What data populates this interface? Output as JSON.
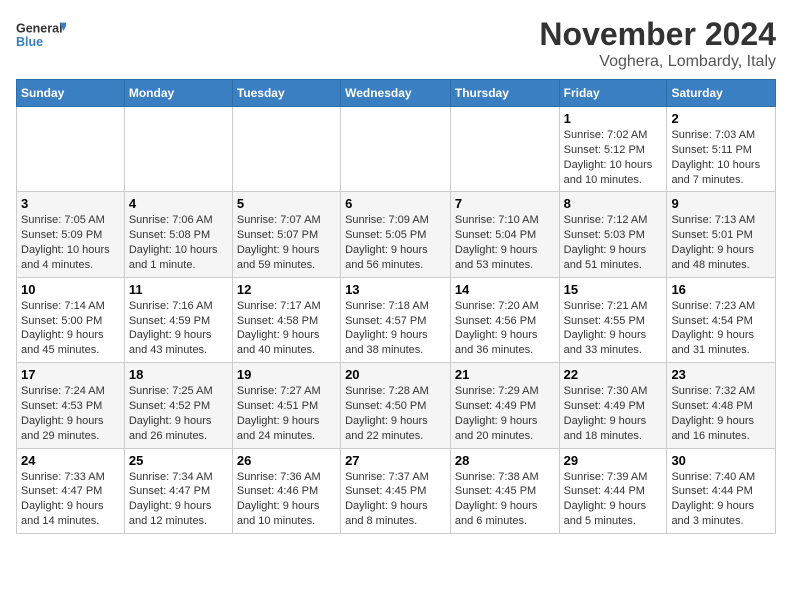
{
  "logo": {
    "line1": "General",
    "line2": "Blue"
  },
  "title": "November 2024",
  "location": "Voghera, Lombardy, Italy",
  "days_of_week": [
    "Sunday",
    "Monday",
    "Tuesday",
    "Wednesday",
    "Thursday",
    "Friday",
    "Saturday"
  ],
  "weeks": [
    [
      {
        "day": "",
        "info": ""
      },
      {
        "day": "",
        "info": ""
      },
      {
        "day": "",
        "info": ""
      },
      {
        "day": "",
        "info": ""
      },
      {
        "day": "",
        "info": ""
      },
      {
        "day": "1",
        "info": "Sunrise: 7:02 AM\nSunset: 5:12 PM\nDaylight: 10 hours and 10 minutes."
      },
      {
        "day": "2",
        "info": "Sunrise: 7:03 AM\nSunset: 5:11 PM\nDaylight: 10 hours and 7 minutes."
      }
    ],
    [
      {
        "day": "3",
        "info": "Sunrise: 7:05 AM\nSunset: 5:09 PM\nDaylight: 10 hours and 4 minutes."
      },
      {
        "day": "4",
        "info": "Sunrise: 7:06 AM\nSunset: 5:08 PM\nDaylight: 10 hours and 1 minute."
      },
      {
        "day": "5",
        "info": "Sunrise: 7:07 AM\nSunset: 5:07 PM\nDaylight: 9 hours and 59 minutes."
      },
      {
        "day": "6",
        "info": "Sunrise: 7:09 AM\nSunset: 5:05 PM\nDaylight: 9 hours and 56 minutes."
      },
      {
        "day": "7",
        "info": "Sunrise: 7:10 AM\nSunset: 5:04 PM\nDaylight: 9 hours and 53 minutes."
      },
      {
        "day": "8",
        "info": "Sunrise: 7:12 AM\nSunset: 5:03 PM\nDaylight: 9 hours and 51 minutes."
      },
      {
        "day": "9",
        "info": "Sunrise: 7:13 AM\nSunset: 5:01 PM\nDaylight: 9 hours and 48 minutes."
      }
    ],
    [
      {
        "day": "10",
        "info": "Sunrise: 7:14 AM\nSunset: 5:00 PM\nDaylight: 9 hours and 45 minutes."
      },
      {
        "day": "11",
        "info": "Sunrise: 7:16 AM\nSunset: 4:59 PM\nDaylight: 9 hours and 43 minutes."
      },
      {
        "day": "12",
        "info": "Sunrise: 7:17 AM\nSunset: 4:58 PM\nDaylight: 9 hours and 40 minutes."
      },
      {
        "day": "13",
        "info": "Sunrise: 7:18 AM\nSunset: 4:57 PM\nDaylight: 9 hours and 38 minutes."
      },
      {
        "day": "14",
        "info": "Sunrise: 7:20 AM\nSunset: 4:56 PM\nDaylight: 9 hours and 36 minutes."
      },
      {
        "day": "15",
        "info": "Sunrise: 7:21 AM\nSunset: 4:55 PM\nDaylight: 9 hours and 33 minutes."
      },
      {
        "day": "16",
        "info": "Sunrise: 7:23 AM\nSunset: 4:54 PM\nDaylight: 9 hours and 31 minutes."
      }
    ],
    [
      {
        "day": "17",
        "info": "Sunrise: 7:24 AM\nSunset: 4:53 PM\nDaylight: 9 hours and 29 minutes."
      },
      {
        "day": "18",
        "info": "Sunrise: 7:25 AM\nSunset: 4:52 PM\nDaylight: 9 hours and 26 minutes."
      },
      {
        "day": "19",
        "info": "Sunrise: 7:27 AM\nSunset: 4:51 PM\nDaylight: 9 hours and 24 minutes."
      },
      {
        "day": "20",
        "info": "Sunrise: 7:28 AM\nSunset: 4:50 PM\nDaylight: 9 hours and 22 minutes."
      },
      {
        "day": "21",
        "info": "Sunrise: 7:29 AM\nSunset: 4:49 PM\nDaylight: 9 hours and 20 minutes."
      },
      {
        "day": "22",
        "info": "Sunrise: 7:30 AM\nSunset: 4:49 PM\nDaylight: 9 hours and 18 minutes."
      },
      {
        "day": "23",
        "info": "Sunrise: 7:32 AM\nSunset: 4:48 PM\nDaylight: 9 hours and 16 minutes."
      }
    ],
    [
      {
        "day": "24",
        "info": "Sunrise: 7:33 AM\nSunset: 4:47 PM\nDaylight: 9 hours and 14 minutes."
      },
      {
        "day": "25",
        "info": "Sunrise: 7:34 AM\nSunset: 4:47 PM\nDaylight: 9 hours and 12 minutes."
      },
      {
        "day": "26",
        "info": "Sunrise: 7:36 AM\nSunset: 4:46 PM\nDaylight: 9 hours and 10 minutes."
      },
      {
        "day": "27",
        "info": "Sunrise: 7:37 AM\nSunset: 4:45 PM\nDaylight: 9 hours and 8 minutes."
      },
      {
        "day": "28",
        "info": "Sunrise: 7:38 AM\nSunset: 4:45 PM\nDaylight: 9 hours and 6 minutes."
      },
      {
        "day": "29",
        "info": "Sunrise: 7:39 AM\nSunset: 4:44 PM\nDaylight: 9 hours and 5 minutes."
      },
      {
        "day": "30",
        "info": "Sunrise: 7:40 AM\nSunset: 4:44 PM\nDaylight: 9 hours and 3 minutes."
      }
    ]
  ]
}
